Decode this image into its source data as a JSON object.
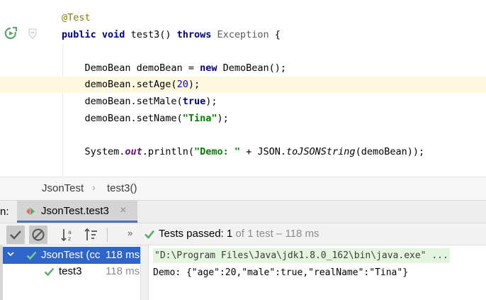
{
  "editor": {
    "gutter_icons": [
      "run-test-icon",
      "fold-marker-icon"
    ],
    "lines": [
      [
        {
          "t": "@Test",
          "c": "ann"
        }
      ],
      [
        {
          "t": "public",
          "c": "kw"
        },
        {
          "t": " ",
          "c": "punc"
        },
        {
          "t": "void",
          "c": "kw"
        },
        {
          "t": " test3() ",
          "c": "punc"
        },
        {
          "t": "throws",
          "c": "kw"
        },
        {
          "t": " ",
          "c": "punc"
        },
        {
          "t": "Exception",
          "c": "exc"
        },
        {
          "t": " {",
          "c": "punc"
        }
      ],
      [],
      [
        {
          "t": "    DemoBean demoBean = ",
          "c": "punc"
        },
        {
          "t": "new",
          "c": "kw"
        },
        {
          "t": " DemoBean();",
          "c": "punc"
        }
      ],
      [
        {
          "t": "    demoBean.setAge(",
          "c": "punc"
        },
        {
          "t": "20",
          "c": "num"
        },
        {
          "t": ");",
          "c": "punc"
        }
      ],
      [
        {
          "t": "    demoBean.setMale(",
          "c": "punc"
        },
        {
          "t": "true",
          "c": "kw"
        },
        {
          "t": ");",
          "c": "punc"
        }
      ],
      [
        {
          "t": "    demoBean.setName(",
          "c": "punc"
        },
        {
          "t": "\"Tina\"",
          "c": "str"
        },
        {
          "t": ");",
          "c": "punc"
        }
      ],
      [],
      [
        {
          "t": "    System.",
          "c": "punc"
        },
        {
          "t": "out",
          "c": "fld"
        },
        {
          "t": ".println(",
          "c": "punc"
        },
        {
          "t": "\"Demo: \"",
          "c": "str"
        },
        {
          "t": " + JSON.",
          "c": "punc"
        },
        {
          "t": "toJSONString",
          "c": "stat"
        },
        {
          "t": "(demoBean));",
          "c": "punc"
        }
      ]
    ],
    "highlighted_line": 4
  },
  "breadcrumb": {
    "class_name": "JsonTest",
    "method_name": "test3()"
  },
  "run_panel": {
    "label": "n:",
    "tab_label": "JsonTest.test3",
    "tab_close": "×"
  },
  "toolbar": {
    "more": "»",
    "status_prefix": "Tests passed: ",
    "status_count": "1",
    "status_suffix": " of 1 test – 118 ms"
  },
  "test_tree": {
    "root_label": "JsonTest (cc",
    "root_time": "118 ms",
    "child_label": "test3",
    "child_time": "118 ms"
  },
  "console": {
    "command": "\"D:\\Program Files\\Java\\jdk1.8.0_162\\bin\\java.exe\" ...",
    "output": "Demo: {\"age\":20,\"male\":true,\"realName\":\"Tina\"}"
  },
  "colors": {
    "accent": "#3f73c6",
    "selection": "#2f65ca",
    "pass_green": "#59a869",
    "highlight_line": "#fdf8de"
  }
}
